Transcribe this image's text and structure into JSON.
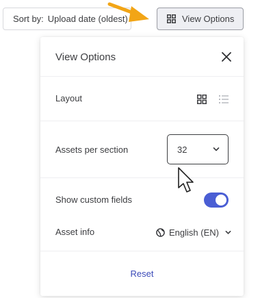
{
  "toolbar": {
    "sort_prefix": "Sort by:",
    "sort_value": "Upload date (oldest)",
    "view_options_label": "View Options"
  },
  "panel": {
    "title": "View Options",
    "layout": {
      "label": "Layout",
      "selected": "grid"
    },
    "assets_per_section": {
      "label": "Assets per section",
      "value": "32"
    },
    "custom_fields": {
      "label": "Show custom fields",
      "enabled": true
    },
    "asset_info": {
      "label": "Asset info",
      "value": "English (EN)"
    },
    "reset_label": "Reset"
  },
  "colors": {
    "accent": "#4a5ed4",
    "link": "#3b4ab8",
    "annotation_arrow": "#f2a516"
  },
  "icons": [
    "grid-icon",
    "list-icon",
    "close-icon",
    "chevron-down-icon",
    "globe-icon",
    "mouse-pointer-icon"
  ]
}
